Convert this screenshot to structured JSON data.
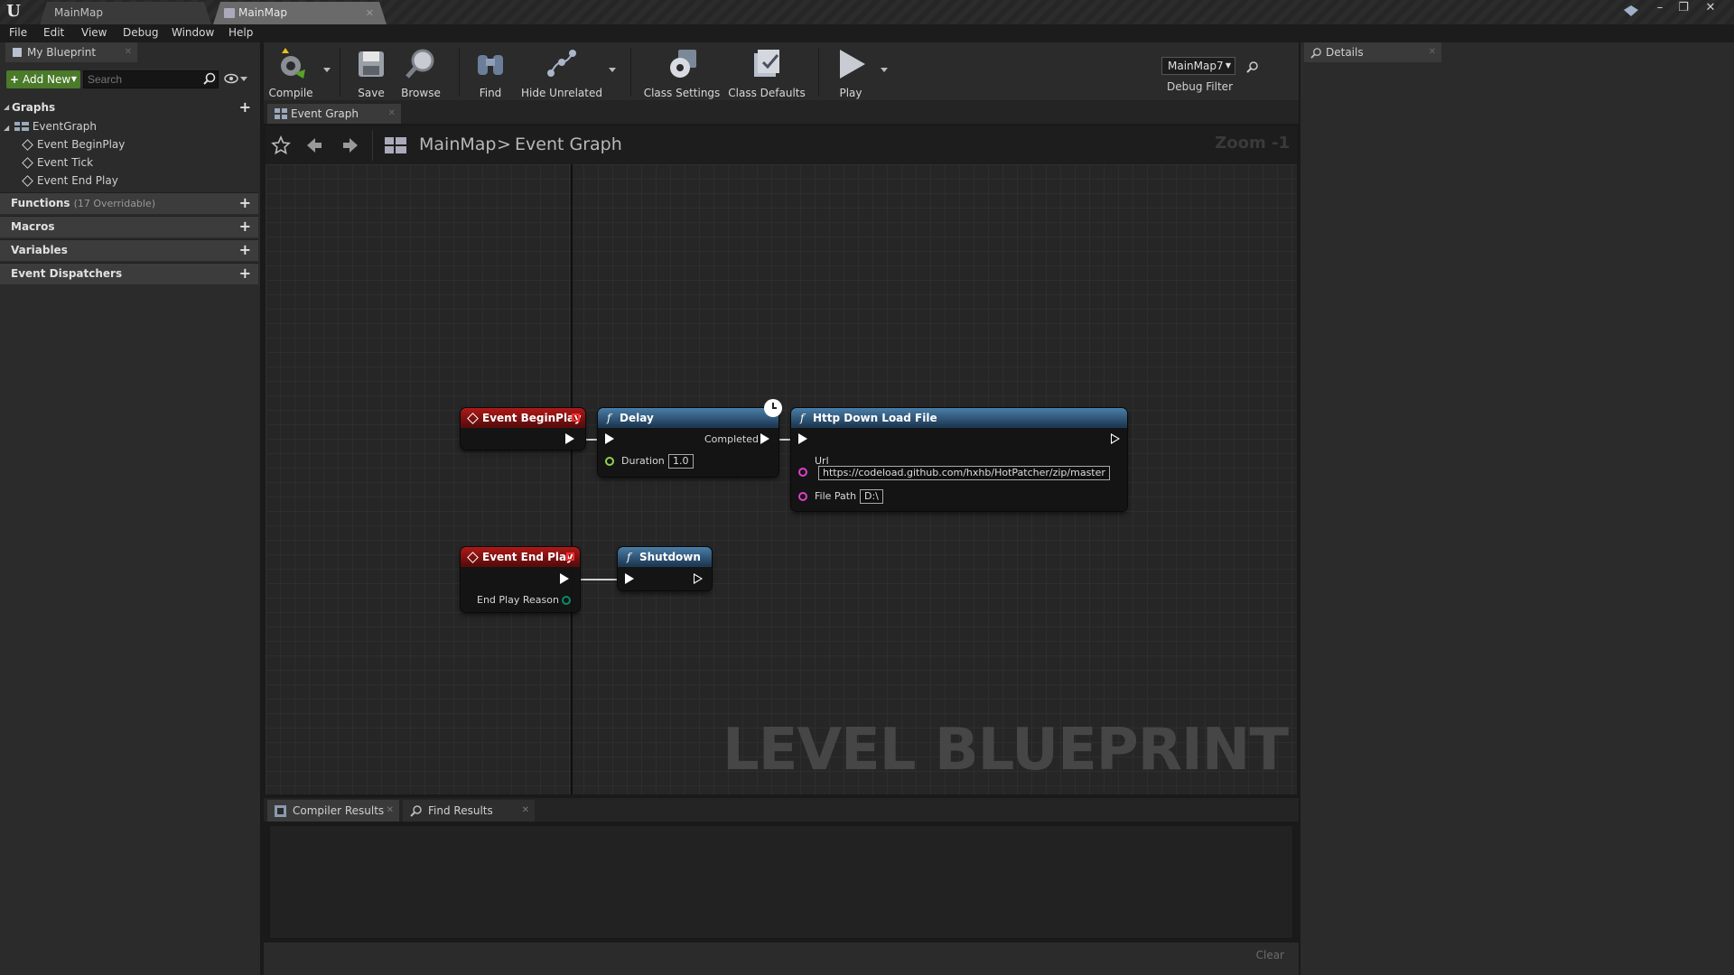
{
  "window": {
    "tabs": [
      {
        "label": "MainMap",
        "active": false
      },
      {
        "label": "MainMap",
        "active": true
      }
    ],
    "controls": {
      "minimize": "–",
      "maximize": "❐",
      "close": "✕"
    }
  },
  "menu": [
    "File",
    "Edit",
    "View",
    "Debug",
    "Window",
    "Help"
  ],
  "left_panel": {
    "tab_label": "My Blueprint",
    "add_new_label": "Add New",
    "search_placeholder": "Search",
    "graphs_label": "Graphs",
    "event_graph_label": "EventGraph",
    "events": [
      "Event BeginPlay",
      "Event Tick",
      "Event End Play"
    ],
    "functions_label": "Functions",
    "functions_sub": "(17 Overridable)",
    "macros_label": "Macros",
    "variables_label": "Variables",
    "dispatchers_label": "Event Dispatchers"
  },
  "toolbar": {
    "compile": "Compile",
    "save": "Save",
    "browse": "Browse",
    "find": "Find",
    "hide_unrelated": "Hide Unrelated",
    "class_settings": "Class Settings",
    "class_defaults": "Class Defaults",
    "play": "Play",
    "debug_object": "MainMap7",
    "debug_filter": "Debug Filter"
  },
  "graph_tab": {
    "label": "Event Graph"
  },
  "breadcrumb": {
    "root": "MainMap",
    "separator": ">",
    "current": "Event Graph",
    "zoom": "Zoom -1"
  },
  "graph": {
    "watermark": "LEVEL BLUEPRINT",
    "nodes": {
      "begin_play": {
        "title": "Event BeginPlay"
      },
      "delay": {
        "title": "Delay",
        "out_label": "Completed",
        "duration_label": "Duration",
        "duration_value": "1.0"
      },
      "http": {
        "title": "Http Down Load File",
        "url_label": "Url",
        "url_value": "https://codeload.github.com/hxhb/HotPatcher/zip/master",
        "filepath_label": "File Path",
        "filepath_value": "D:\\"
      },
      "end_play": {
        "title": "Event End Play",
        "reason_label": "End Play Reason"
      },
      "shutdown": {
        "title": "Shutdown"
      }
    },
    "colors": {
      "event_header": "#b01818",
      "function_header": "#4a7ea8",
      "float_pin": "#8fd14f",
      "string_pin": "#e040c8",
      "enum_pin": "#0a8a6a"
    }
  },
  "bottom": {
    "tabs": [
      "Compiler Results",
      "Find Results"
    ],
    "clear_label": "Clear"
  },
  "right_panel": {
    "tab_label": "Details"
  }
}
